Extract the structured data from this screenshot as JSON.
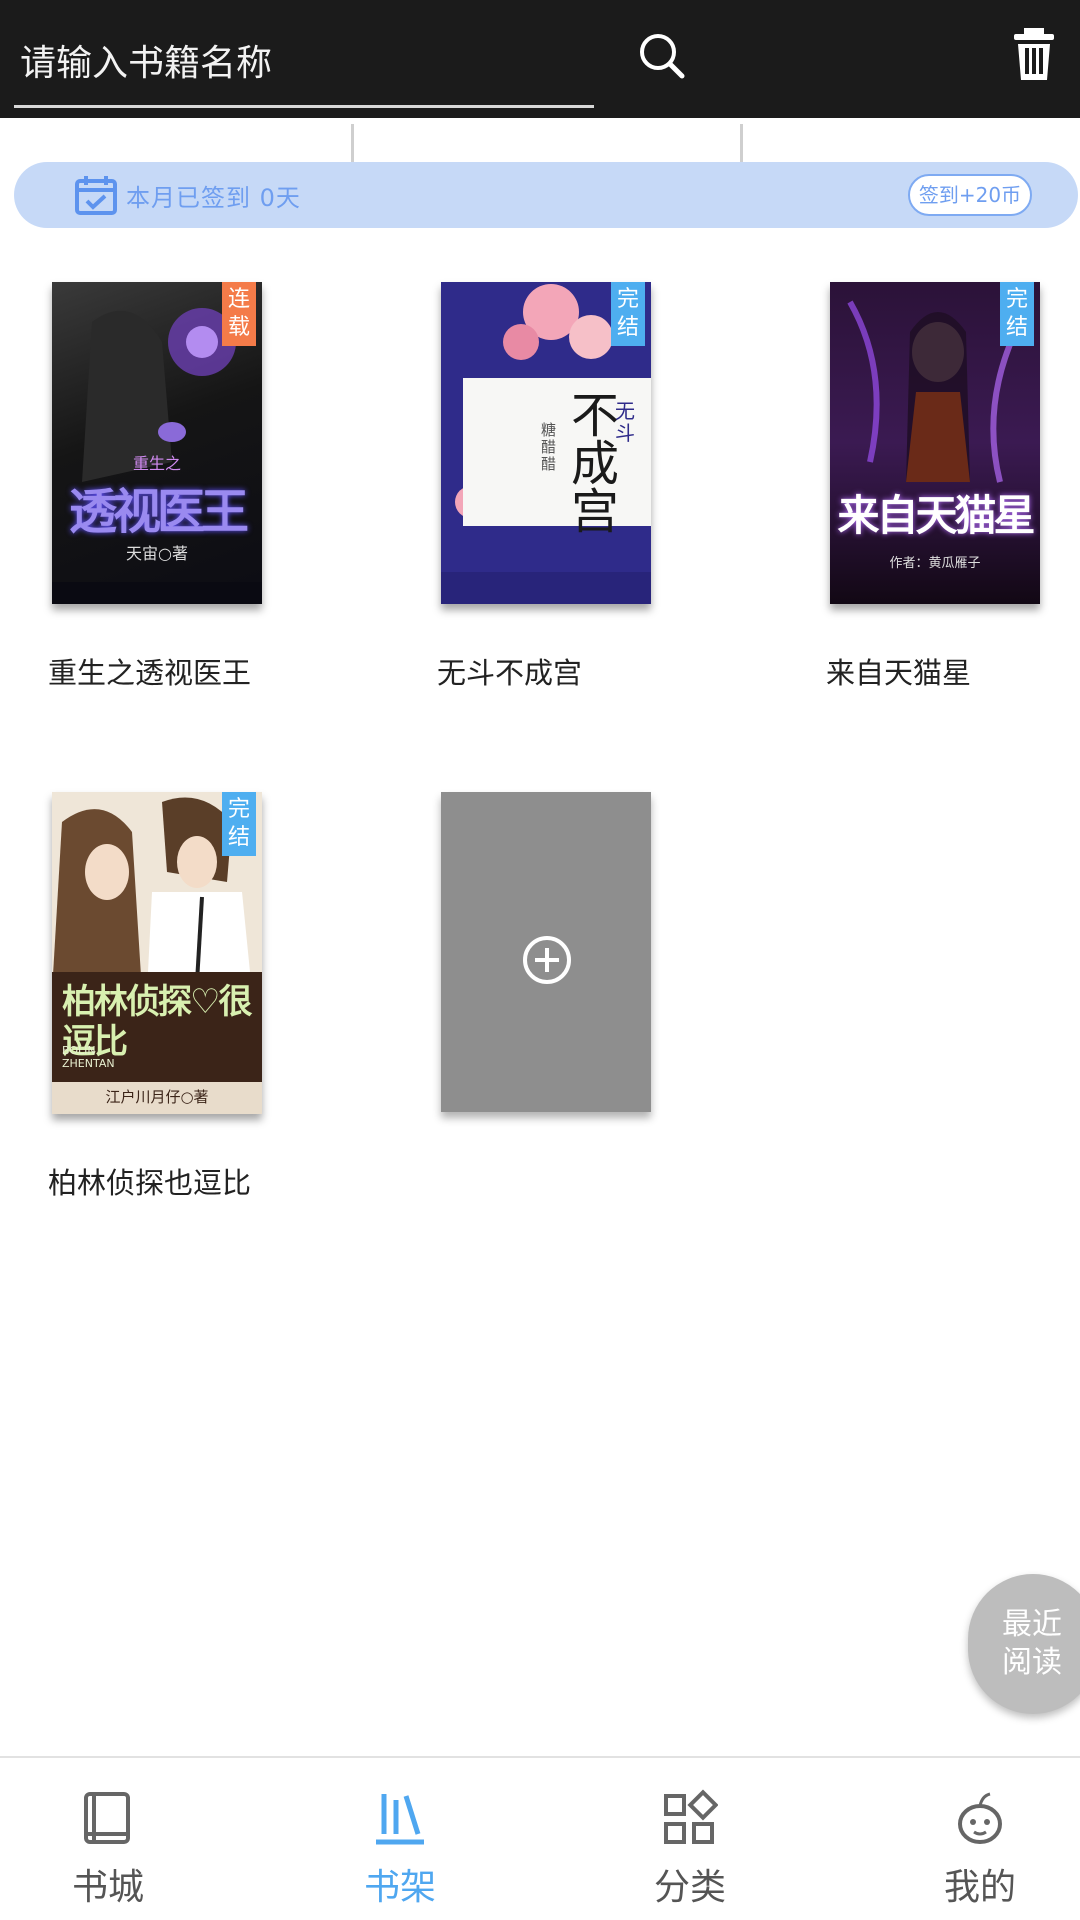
{
  "search": {
    "placeholder": "请输入书籍名称"
  },
  "signin": {
    "status_text": "本月已签到  0天",
    "button_label": "签到+20币"
  },
  "books": [
    {
      "title": "重生之透视医王",
      "tag": "连载",
      "cover_text": "透视医王",
      "cover_sub": "重生之",
      "author": "天宙○著"
    },
    {
      "title": "无斗不成宫",
      "tag": "完结",
      "cover_text": "不成宫",
      "cover_sub": "无斗",
      "author": "糖醋醋"
    },
    {
      "title": "来自天猫星",
      "tag": "完结",
      "cover_text": "来自天猫星",
      "cover_sub": "",
      "author": "作者：黄瓜雁子"
    },
    {
      "title": "柏林侦探也逗比",
      "tag": "完结",
      "cover_text": "柏林侦探♡很逗比",
      "cover_sub": "BOLIN ZHENTAN",
      "author": "江户川月仔○著"
    }
  ],
  "recent_read": {
    "label": "最近阅读"
  },
  "nav": [
    {
      "label": "书城",
      "icon": "book-icon"
    },
    {
      "label": "书架",
      "icon": "bookshelf-icon"
    },
    {
      "label": "分类",
      "icon": "category-grid-icon"
    },
    {
      "label": "我的",
      "icon": "profile-mascot-icon"
    }
  ],
  "colors": {
    "topbar": "#1b1b1b",
    "accent": "#4fa7f0",
    "signin_bg": "#c6d9f7",
    "tag_serializing": "#f47b49",
    "tag_finished": "#4eaef0"
  }
}
